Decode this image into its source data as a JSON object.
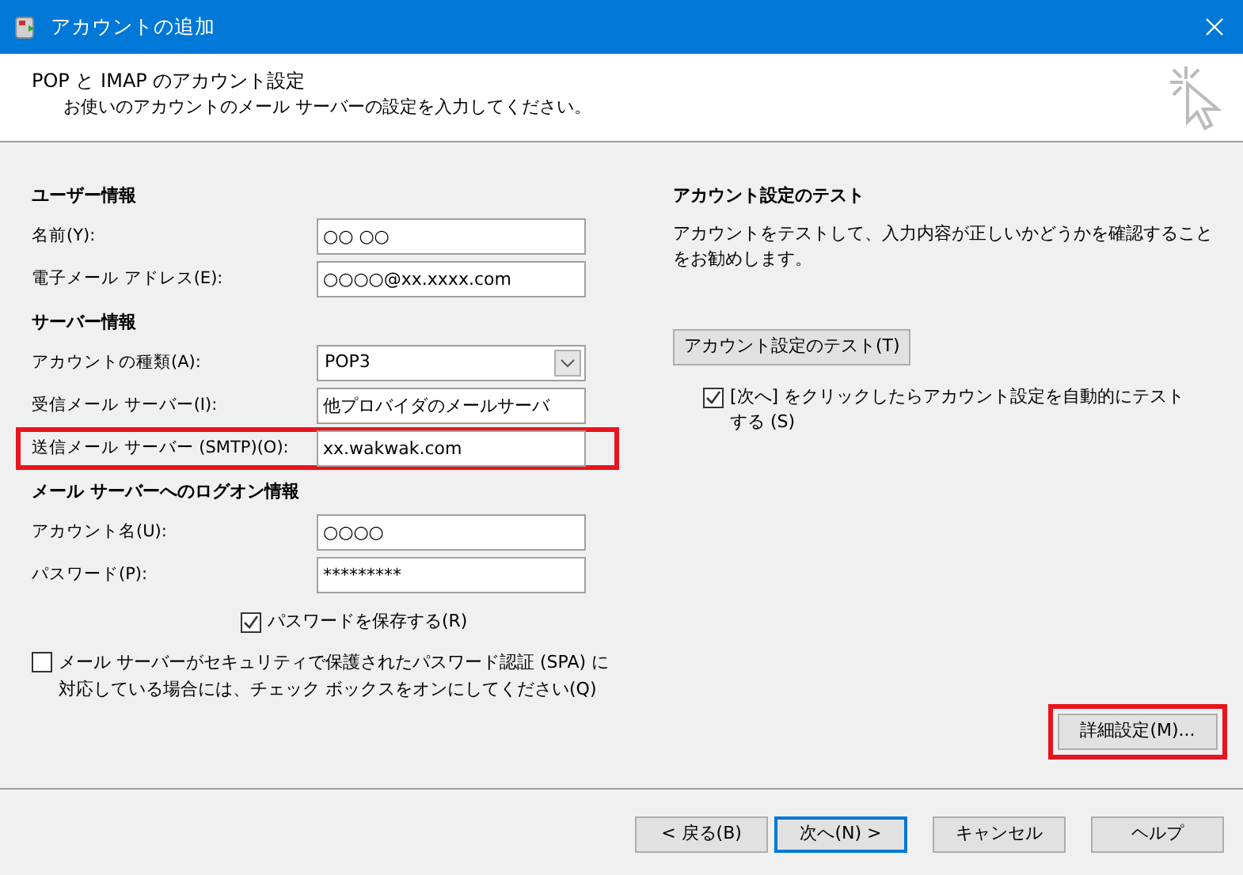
{
  "window": {
    "title": "アカウントの追加"
  },
  "header": {
    "title": "POP と IMAP のアカウント設定",
    "subtitle": "お使いのアカウントのメール サーバーの設定を入力してください。"
  },
  "left_fields": [
    {
      "kind": "heading",
      "label": "ユーザー情報"
    },
    {
      "kind": "text",
      "label": "名前(Y):",
      "value": "○○ ○○",
      "highlighted": false
    },
    {
      "kind": "text",
      "label": "電子メール アドレス(E):",
      "value": "○○○○@xx.xxxx.com",
      "highlighted": false
    },
    {
      "kind": "heading",
      "label": "サーバー情報"
    },
    {
      "kind": "select",
      "label": "アカウントの種類(A):",
      "value": "POP3",
      "highlighted": false
    },
    {
      "kind": "text",
      "label": "受信メール サーバー(I):",
      "value": "他プロバイダのメールサーバ",
      "highlighted": false
    },
    {
      "kind": "text",
      "label": "送信メール サーバー (SMTP)(O):",
      "value": "xx.wakwak.com",
      "highlighted": true
    },
    {
      "kind": "heading",
      "label": "メール サーバーへのログオン情報"
    },
    {
      "kind": "text",
      "label": "アカウント名(U):",
      "value": "○○○○",
      "highlighted": false
    },
    {
      "kind": "text",
      "label": "パスワード(P):",
      "value": "*********",
      "highlighted": false
    }
  ],
  "save_password": {
    "label": "パスワードを保存する(R)",
    "checked": true
  },
  "spa": {
    "label": "メール サーバーがセキュリティで保護されたパスワード認証 (SPA) に対応している場合には、チェック ボックスをオンにしてください(Q)",
    "checked": false
  },
  "test": {
    "heading": "アカウント設定のテスト",
    "description": "アカウントをテストして、入力内容が正しいかどうかを確認することをお勧めします。",
    "button": "アカウント設定のテスト(T)",
    "auto_test": {
      "label": "[次へ] をクリックしたらアカウント設定を自動的にテストする (S)",
      "checked": true
    }
  },
  "advanced_button": {
    "label": "詳細設定(M)...",
    "highlighted": true
  },
  "buttons": [
    {
      "label": "< 戻る(B)",
      "default": false
    },
    {
      "label": "次へ(N) >",
      "default": true
    },
    {
      "label": "キャンセル",
      "default": false
    },
    {
      "label": "ヘルプ",
      "default": false
    }
  ]
}
